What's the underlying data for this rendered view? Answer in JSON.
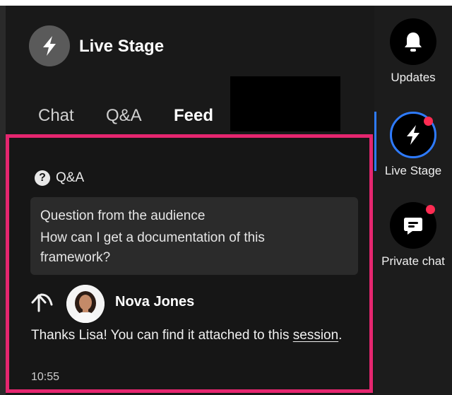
{
  "header": {
    "title": "Live Stage"
  },
  "tabs": [
    {
      "label": "Chat"
    },
    {
      "label": "Q&A"
    },
    {
      "label": "Feed"
    }
  ],
  "feed": {
    "section_label": "Q&A",
    "question": {
      "label": "Question from the audience",
      "text": "How can I get a documentation of this framework?"
    },
    "reply": {
      "author": "Nova Jones",
      "text_before": "Thanks Lisa! You can find it attached to this ",
      "link_text": "session",
      "text_after": ".",
      "time": "10:55"
    }
  },
  "sidebar": {
    "items": [
      {
        "label": "Updates",
        "icon": "bell-icon"
      },
      {
        "label": "Live Stage",
        "icon": "lightning-icon"
      },
      {
        "label": "Private chat",
        "icon": "chat-icon"
      }
    ]
  },
  "colors": {
    "highlight": "#e5266f",
    "accent": "#2e7bff",
    "badge": "#ff2b52"
  }
}
